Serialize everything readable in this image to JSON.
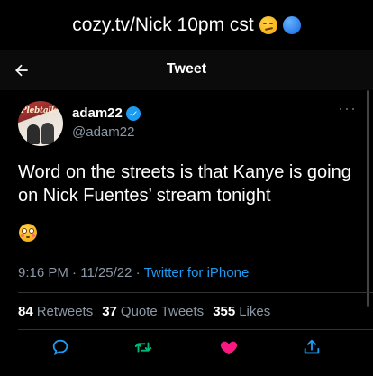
{
  "caption": {
    "text": "cozy.tv/Nick 10pm cst"
  },
  "topbar": {
    "title": "Tweet"
  },
  "tweet": {
    "author_name": "adam22",
    "author_handle": "@adam22",
    "avatar_text": "Plebtalk",
    "text": "Word on the streets is that Kanye is going on Nick Fuentes’ stream tonight",
    "time": "9:16 PM",
    "separator1": " · ",
    "date": "11/25/22",
    "separator2": " · ",
    "source": "Twitter for iPhone",
    "stats": {
      "retweets_count": "84",
      "retweets_label": "Retweets",
      "quotes_count": "37",
      "quotes_label": "Quote Tweets",
      "likes_count": "355",
      "likes_label": "Likes"
    }
  },
  "colors": {
    "background": "#000000",
    "accent": "#1d9bf0",
    "retweet": "#00ba7c",
    "like": "#f91880",
    "muted": "#8b98a5"
  }
}
